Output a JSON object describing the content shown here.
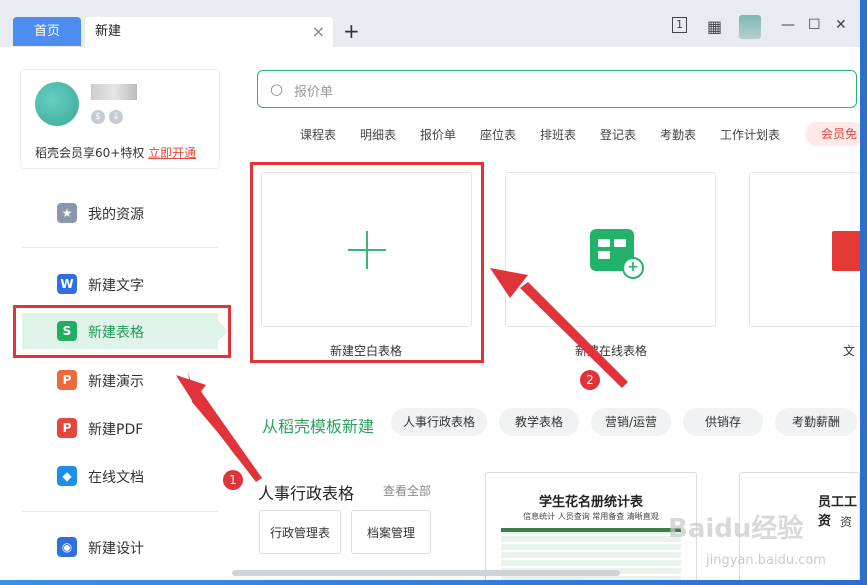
{
  "tabs": {
    "home": "首页",
    "current": "新建",
    "close_icon": "close-icon",
    "add_icon": "plus-icon"
  },
  "titlebar": {
    "icons": [
      "reader-mode-icon",
      "grid-apps-icon",
      "avatar",
      "minimize-icon",
      "maximize-icon",
      "close-icon"
    ],
    "reader_glyph": "1",
    "grid_glyph": "▦",
    "min_glyph": "—",
    "max_glyph": "☐",
    "close_glyph": "✕"
  },
  "user": {
    "vip_text": "稻壳会员享60+特权",
    "vip_link": "立即开通"
  },
  "sidebar": {
    "items": [
      {
        "label": "我的资源",
        "icon": "resource-icon",
        "glyph": "★",
        "color": "#8a96ae"
      },
      {
        "label": "新建文字",
        "icon": "word-icon",
        "glyph": "W",
        "color": "#2f6fe0"
      },
      {
        "label": "新建表格",
        "icon": "sheet-icon",
        "glyph": "S",
        "color": "#22ad62"
      },
      {
        "label": "新建演示",
        "icon": "slides-icon",
        "glyph": "P",
        "color": "#ec6a3c"
      },
      {
        "label": "新建PDF",
        "icon": "pdf-icon",
        "glyph": "P",
        "color": "#e5473c"
      },
      {
        "label": "在线文档",
        "icon": "online-doc-icon",
        "glyph": "◆",
        "color": "#1e8fe8"
      },
      {
        "label": "新建设计",
        "icon": "design-icon",
        "glyph": "◉",
        "color": "#2f6fe0"
      }
    ]
  },
  "search": {
    "placeholder": "报价单"
  },
  "quick_tags": [
    "课程表",
    "明细表",
    "报价单",
    "座位表",
    "排班表",
    "登记表",
    "考勤表",
    "工作计划表"
  ],
  "member_pill": "会员免",
  "cards": [
    {
      "label": "新建空白表格"
    },
    {
      "label": "新建在线表格"
    },
    {
      "label": "文"
    }
  ],
  "template_section": {
    "title": "从稻壳模板新建",
    "chips": [
      "人事行政表格",
      "教学表格",
      "营销/运营",
      "供销存",
      "考勤薪酬"
    ]
  },
  "category": {
    "title": "人事行政表格",
    "view_all": "查看全部",
    "buttons": [
      "行政管理表",
      "档案管理"
    ]
  },
  "templates": [
    {
      "title": "学生花名册统计表",
      "subtitle": "信息统计 人员查询 常用备查 清晰直观"
    },
    {
      "title": "员工工资",
      "subtitle": "资"
    }
  ],
  "annotations": [
    "1",
    "2"
  ],
  "watermark": {
    "text": "Baidu经验",
    "sub": "jingyan.baidu.com"
  }
}
